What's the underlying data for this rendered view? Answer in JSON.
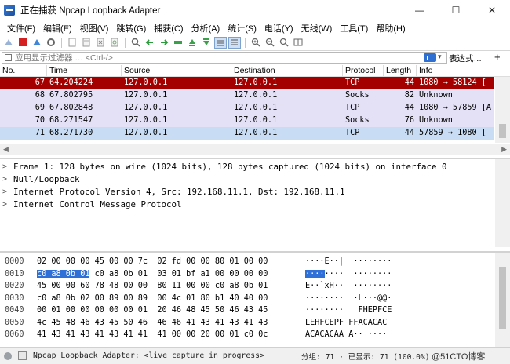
{
  "window": {
    "title": "正在捕获 Npcap Loopback Adapter",
    "controls": [
      "—",
      "☐",
      "✕"
    ]
  },
  "menu": [
    "文件(F)",
    "编辑(E)",
    "视图(V)",
    "跳转(G)",
    "捕获(C)",
    "分析(A)",
    "统计(S)",
    "电话(Y)",
    "无线(W)",
    "工具(T)",
    "帮助(H)"
  ],
  "filter": {
    "placeholder": "应用显示过滤器 … <Ctrl-/>",
    "expression_label": "表达式…",
    "plus": "+",
    "dropdown": "▾"
  },
  "packet_list": {
    "columns": [
      "No.",
      "Time",
      "Source",
      "Destination",
      "Protocol",
      "Length",
      "Info"
    ],
    "rows": [
      {
        "no": "67",
        "time": "64.204224",
        "src": "127.0.0.1",
        "dst": "127.0.0.1",
        "proto": "TCP",
        "len": "44",
        "info": "1080 → 58124 [",
        "style": "sel"
      },
      {
        "no": "68",
        "time": "67.802795",
        "src": "127.0.0.1",
        "dst": "127.0.0.1",
        "proto": "Socks",
        "len": "82",
        "info": "Unknown",
        "style": "socks"
      },
      {
        "no": "69",
        "time": "67.802848",
        "src": "127.0.0.1",
        "dst": "127.0.0.1",
        "proto": "TCP",
        "len": "44",
        "info": "1080 → 57859 [A",
        "style": "tcp"
      },
      {
        "no": "70",
        "time": "68.271547",
        "src": "127.0.0.1",
        "dst": "127.0.0.1",
        "proto": "Socks",
        "len": "76",
        "info": "Unknown",
        "style": "socks"
      },
      {
        "no": "71",
        "time": "68.271730",
        "src": "127.0.0.1",
        "dst": "127.0.0.1",
        "proto": "TCP",
        "len": "44",
        "info": "57859 → 1080 [",
        "style": "last"
      }
    ]
  },
  "details": [
    "Frame 1: 128 bytes on wire (1024 bits), 128 bytes captured (1024 bits) on interface 0",
    "Null/Loopback",
    "Internet Protocol Version 4, Src: 192.168.11.1, Dst: 192.168.11.1",
    "Internet Control Message Protocol"
  ],
  "hex": [
    {
      "off": "0000",
      "hex_pre": "",
      "hex_hl": "",
      "hex": "02 00 00 00 45 00 00 7c  02 fd 00 00 80 01 00 00",
      "ascii_pre": "",
      "ascii_hl": "",
      "ascii": "····E··|  ········"
    },
    {
      "off": "0010",
      "hex_pre": "",
      "hex_hl": "c0 a8 0b 01",
      "hex": " c0 a8 0b 01  03 01 bf a1 00 00 00 00",
      "ascii_pre": "",
      "ascii_hl": "····",
      "ascii": "····  ········"
    },
    {
      "off": "0020",
      "hex_pre": "",
      "hex_hl": "",
      "hex": "45 00 00 60 78 48 00 00  80 11 00 00 c0 a8 0b 01",
      "ascii_pre": "",
      "ascii_hl": "",
      "ascii": "E··`xH··  ········"
    },
    {
      "off": "0030",
      "hex_pre": "",
      "hex_hl": "",
      "hex": "c0 a8 0b 02 00 89 00 89  00 4c 01 80 b1 40 40 00",
      "ascii_pre": "",
      "ascii_hl": "",
      "ascii": "········  ·L···@@·"
    },
    {
      "off": "0040",
      "hex_pre": "",
      "hex_hl": "",
      "hex": "00 01 00 00 00 00 00 01  20 46 48 45 50 46 43 45",
      "ascii_pre": "",
      "ascii_hl": "",
      "ascii": "········   FHEPFCE"
    },
    {
      "off": "0050",
      "hex_pre": "",
      "hex_hl": "",
      "hex": "4c 45 48 46 43 45 50 46  46 46 41 43 41 43 41 43",
      "ascii_pre": "",
      "ascii_hl": "",
      "ascii": "LEHFCEPF FFACACAC"
    },
    {
      "off": "0060",
      "hex_pre": "",
      "hex_hl": "",
      "hex": "41 43 41 43 41 43 41 41  41 00 00 20 00 01 c0 0c",
      "ascii_pre": "",
      "ascii_hl": "",
      "ascii": "ACACACAA A·· ····"
    }
  ],
  "status": {
    "interface": "Npcap Loopback Adapter: <live capture in progress>",
    "stats": "分组: 71 · 已显示: 71 (100.0%)",
    "watermark": "@51CTO博客"
  },
  "colors": {
    "selected_row": "#a40000",
    "tcp_row": "#e4e0f6",
    "hex_highlight": "#2e6fd8"
  }
}
